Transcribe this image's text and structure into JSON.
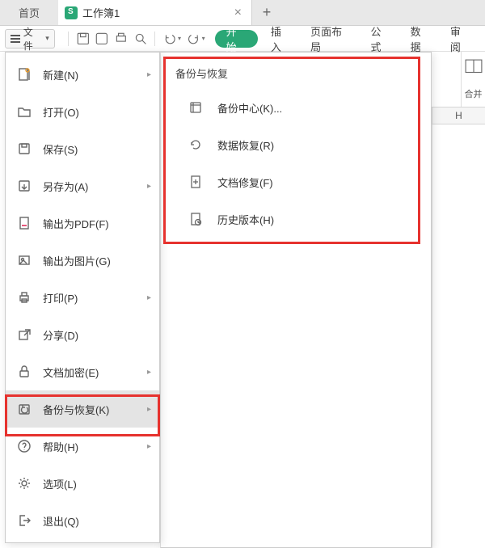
{
  "tabs": {
    "home": "首页",
    "doc_title": "工作簿1",
    "close_glyph": "×",
    "add_glyph": "+"
  },
  "file_button": {
    "label": "文件",
    "caret": "▾"
  },
  "ribbon_tabs": {
    "start": "开始",
    "insert": "插入",
    "layout": "页面布局",
    "formula": "公式",
    "data": "数据",
    "review": "审阅"
  },
  "rightbar": {
    "merge_label": "合并"
  },
  "sheet": {
    "col_h": "H"
  },
  "file_menu": {
    "new": "新建(N)",
    "open": "打开(O)",
    "save": "保存(S)",
    "save_as": "另存为(A)",
    "export_pdf": "输出为PDF(F)",
    "export_img": "输出为图片(G)",
    "print": "打印(P)",
    "share": "分享(D)",
    "encrypt": "文档加密(E)",
    "backup": "备份与恢复(K)",
    "help": "帮助(H)",
    "options": "选项(L)",
    "exit": "退出(Q)",
    "arrow": "▸"
  },
  "submenu": {
    "title": "备份与恢复",
    "backup_center": "备份中心(K)...",
    "data_recover": "数据恢复(R)",
    "doc_repair": "文档修复(F)",
    "history": "历史版本(H)"
  }
}
